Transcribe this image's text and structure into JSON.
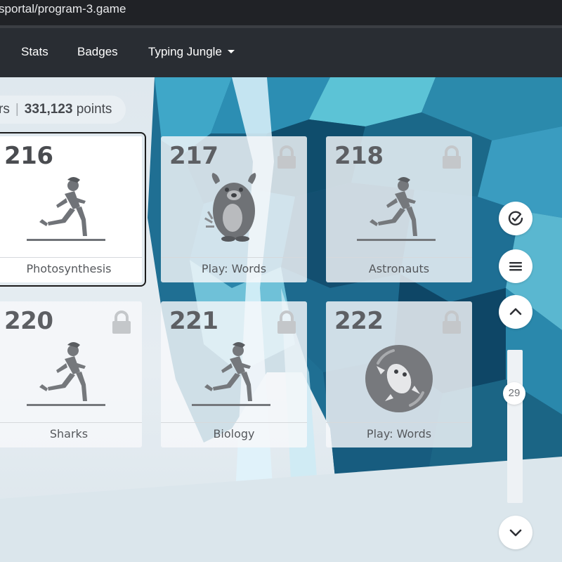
{
  "browser": {
    "url": "sportal/program-3.game"
  },
  "nav": {
    "stats_label": "Stats",
    "badges_label": "Badges",
    "program_label": "Typing Jungle"
  },
  "summary": {
    "stars_fragment": "rs",
    "points_value": "331,123",
    "points_label": "points"
  },
  "cards": [
    {
      "number": "216",
      "label": "Photosynthesis",
      "icon": "runner-icon",
      "locked": false,
      "selected": true
    },
    {
      "number": "217",
      "label": "Play: Words",
      "icon": "bear-pet-icon",
      "locked": true,
      "selected": false
    },
    {
      "number": "218",
      "label": "Astronauts",
      "icon": "runner-icon",
      "locked": true,
      "selected": false
    },
    {
      "number": "220",
      "label": "Sharks",
      "icon": "runner-icon",
      "locked": true,
      "selected": false
    },
    {
      "number": "221",
      "label": "Biology",
      "icon": "runner-icon",
      "locked": true,
      "selected": false
    },
    {
      "number": "222",
      "label": "Play: Words",
      "icon": "bubble-pet-icon",
      "locked": true,
      "selected": false
    }
  ],
  "sidebar": {
    "check_icon": "check-circle-icon",
    "menu_icon": "menu-icon",
    "up_icon": "chevron-up-icon",
    "down_icon": "chevron-down-icon",
    "scroll_value": "29"
  },
  "colors": {
    "navbar": "#292d33",
    "url_bar": "#202226",
    "card_number": "#4a4c50",
    "icon_gray": "#6f7276",
    "background_blue": "#1c6b8f"
  }
}
